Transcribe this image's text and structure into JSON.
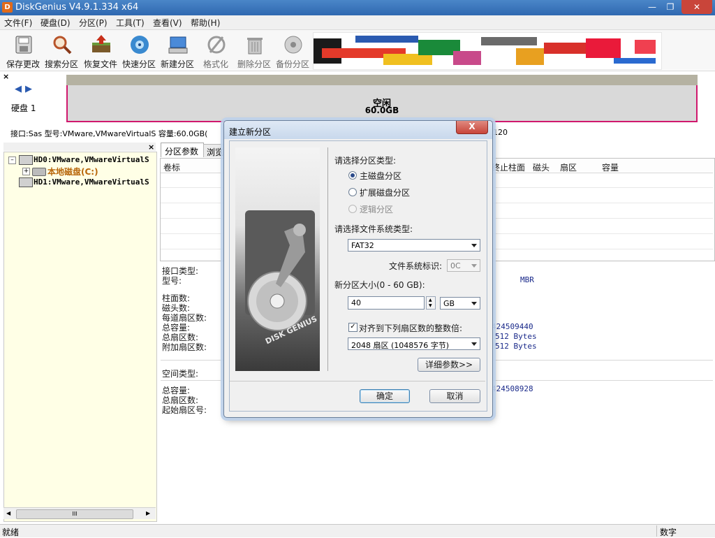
{
  "window": {
    "title": "DiskGenius V4.9.1.334 x64",
    "app_icon_glyph": "D"
  },
  "menu": [
    "文件(F)",
    "硬盘(D)",
    "分区(P)",
    "工具(T)",
    "查看(V)",
    "帮助(H)"
  ],
  "toolbar": [
    {
      "label": "保存更改",
      "icon": "save-icon"
    },
    {
      "label": "搜索分区",
      "icon": "search-icon"
    },
    {
      "label": "恢复文件",
      "icon": "recover-icon"
    },
    {
      "label": "快速分区",
      "icon": "quick-partition-icon"
    },
    {
      "label": "新建分区",
      "icon": "new-partition-icon"
    },
    {
      "label": "格式化",
      "icon": "format-icon"
    },
    {
      "label": "删除分区",
      "icon": "delete-icon"
    },
    {
      "label": "备份分区",
      "icon": "backup-icon"
    }
  ],
  "diskmap": {
    "disk_label": "硬盘 1",
    "free_label": "空闲",
    "free_size": "60.0GB",
    "info": "接口:Sas  型号:VMware,VMwareVirtualS  容量:60.0GB(",
    "info_tail": "120"
  },
  "tree": {
    "items": [
      {
        "label": "HD0:VMware,VMwareVirtualS"
      },
      {
        "label": "本地磁盘(C:)"
      },
      {
        "label": "HD1:VMware,VMwareVirtualS"
      }
    ],
    "hscroll_thumb": "III"
  },
  "tabs": [
    "分区参数",
    "浏览"
  ],
  "table": {
    "headers": [
      "卷标",
      "终止柱面",
      "磁头",
      "扇区",
      "容量"
    ]
  },
  "details": {
    "labels": [
      "接口类型:",
      "型号:",
      "柱面数:",
      "磁头数:",
      "每道扇区数:",
      "总容量:",
      "总扇区数:",
      "附加扇区数:",
      "空间类型:",
      "总容量:",
      "总扇区数:",
      "起始扇区号:"
    ],
    "values": {
      "mbr": "MBR",
      "v1": "424509440",
      "v2": "512 Bytes",
      "v3": "512 Bytes",
      "v4": "424508928"
    }
  },
  "status": {
    "left": "就绪",
    "right": "数字"
  },
  "dialog": {
    "title": "建立新分区",
    "close": "X",
    "image_text": "DISK GENIUS",
    "partition_type_label": "请选择分区类型:",
    "partition_types": [
      {
        "label": "主磁盘分区",
        "selected": true,
        "enabled": true
      },
      {
        "label": "扩展磁盘分区",
        "selected": false,
        "enabled": true
      },
      {
        "label": "逻辑分区",
        "selected": false,
        "enabled": false
      }
    ],
    "fs_type_label": "请选择文件系统类型:",
    "fs_type_value": "FAT32",
    "fs_id_label": "文件系统标识:",
    "fs_id_value": "0C",
    "size_label": "新分区大小(0 - 60 GB):",
    "size_value": "40",
    "size_unit": "GB",
    "align_label": "对齐到下列扇区数的整数倍:",
    "align_checked": true,
    "align_value": "2048 扇区 (1048576 字节)",
    "details_button": "详细参数>>",
    "ok_button": "确定",
    "cancel_button": "取消"
  }
}
